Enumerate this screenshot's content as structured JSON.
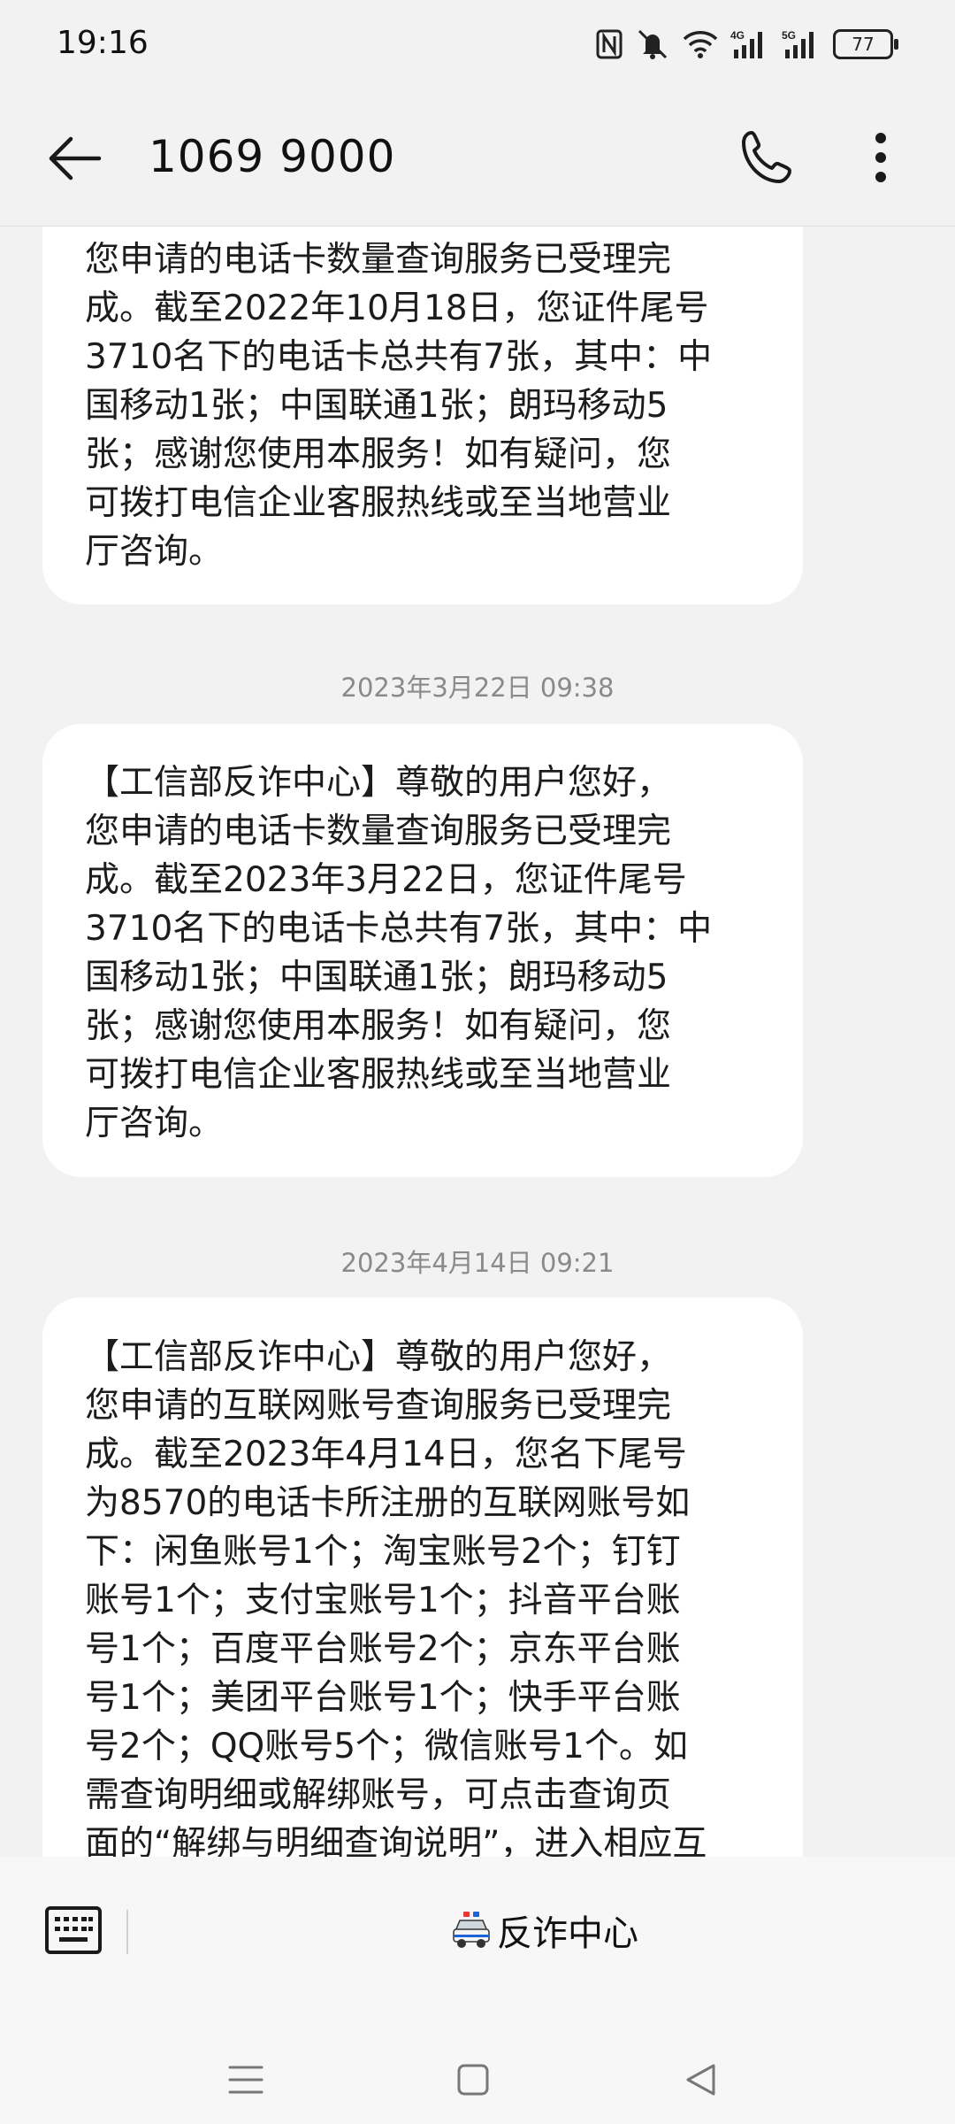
{
  "status_bar": {
    "time": "19:16",
    "battery_level": "77",
    "icons": [
      "nfc-icon",
      "mute-icon",
      "wifi-icon",
      "signal-4g-icon",
      "signal-5g-icon",
      "battery-icon"
    ]
  },
  "header": {
    "title": "1069 9000",
    "icons": [
      "back-arrow-icon",
      "phone-icon",
      "more-vert-icon"
    ]
  },
  "messages": [
    {
      "lines": [
        "您申请的电话卡数量查询服务已受理完",
        "成。截至2022年10月18日，您证件尾号",
        "3710名下的电话卡总共有7张，其中：中",
        "国移动1张；中国联通1张；朗玛移动5",
        "张；感谢您使用本服务！如有疑问，您",
        "可拨打电信企业客服热线或至当地营业",
        "厅咨询。"
      ]
    },
    {
      "timestamp": "2023年3月22日 09:38",
      "lines": [
        "【工信部反诈中心】尊敬的用户您好，",
        "您申请的电话卡数量查询服务已受理完",
        "成。截至2023年3月22日，您证件尾号",
        "3710名下的电话卡总共有7张，其中：中",
        "国移动1张；中国联通1张；朗玛移动5",
        "张；感谢您使用本服务！如有疑问，您",
        "可拨打电信企业客服热线或至当地营业",
        "厅咨询。"
      ]
    },
    {
      "timestamp": "2023年4月14日 09:21",
      "lines": [
        "【工信部反诈中心】尊敬的用户您好，",
        "您申请的互联网账号查询服务已受理完",
        "成。截至2023年4月14日，您名下尾号",
        "为8570的电话卡所注册的互联网账号如",
        "下：闲鱼账号1个；淘宝账号2个；钉钉",
        "账号1个；支付宝账号1个；抖音平台账",
        "号1个；百度平台账号2个；京东平台账",
        "号1个；美团平台账号1个；快手平台账",
        "号2个；QQ账号5个；微信账号1个。如",
        "需查询明细或解绑账号，可点击查询页",
        "面的“解绑与明细查询说明”，进入相应互"
      ]
    }
  ],
  "composer": {
    "quick_reply_label": "反诈中心",
    "icons": [
      "keyboard-icon",
      "police-car-icon"
    ]
  },
  "nav_bar": {
    "icons": [
      "menu-icon",
      "home-icon",
      "back-triangle-icon"
    ]
  }
}
